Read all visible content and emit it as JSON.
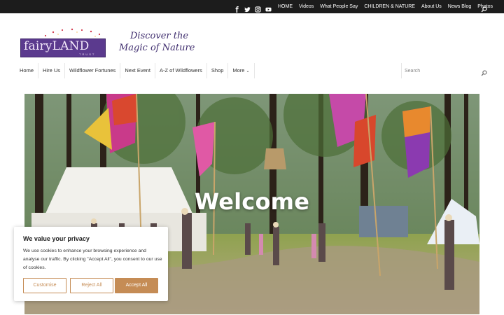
{
  "topbar": {
    "social": [
      "facebook-icon",
      "twitter-icon",
      "instagram-icon",
      "youtube-icon"
    ],
    "links": [
      "HOME",
      "Videos",
      "What People Say",
      "CHILDREN & NATURE",
      "About Us",
      "News Blog",
      "Photos"
    ]
  },
  "logo": {
    "word": "fairyLAND",
    "sub": "TRUST",
    "tagline_1": "Discover the",
    "tagline_2": "Magic of Nature"
  },
  "nav": {
    "items": [
      "Home",
      "Hire Us",
      "Wildflower Fortunes",
      "Next Event",
      "A-Z of Wildflowers",
      "Shop",
      "More"
    ],
    "search_placeholder": "Search"
  },
  "hero": {
    "heading": "Welcome"
  },
  "cookie": {
    "title": "We value your privacy",
    "text": "We use cookies to enhance your browsing experience and analyse our traffic. By clicking \"Accept All\", you consent to our use of cookies.",
    "customise": "Customise",
    "reject": "Reject All",
    "accept": "Accept All"
  },
  "colors": {
    "topbar": "#1c1c1c",
    "brand_purple": "#5b3a8e",
    "accent": "#c58c55"
  }
}
